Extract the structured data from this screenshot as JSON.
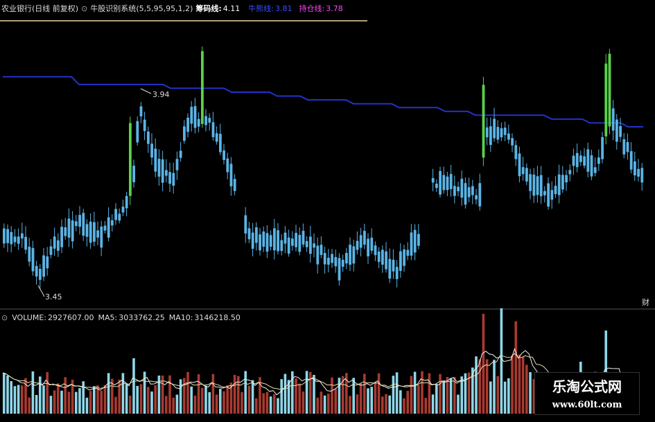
{
  "header": {
    "stock_title": "农业银行(日线 前复权)",
    "indicator_name": "牛股识别系统",
    "indicator_params": "(5,5,95,95,1,2)",
    "chip_line_label": "筹码线:",
    "chip_line_value": "4.11",
    "bull_line_label": "牛熊线:",
    "bull_line_value": "3.81",
    "hold_line_label": "持仓线:",
    "hold_line_value": "3.78",
    "colors": {
      "chip": "#ffffff",
      "bull": "#3b4cff",
      "hold": "#ff44ff"
    }
  },
  "volume_header": {
    "volume_label": "VOLUME:",
    "volume_value": "2927607.00",
    "ma5_label": "MA5:",
    "ma5_value": "3033762.25",
    "ma10_label": "MA10:",
    "ma10_value": "3146218.50"
  },
  "side_marker": "财",
  "watermark": {
    "name": "乐淘公式网",
    "url": "www.60lt.com"
  },
  "chart_data": [
    {
      "type": "candlestick",
      "price_high_label": "3.94",
      "price_low_label": "3.45",
      "colors": {
        "up": "#5ab4e6",
        "breakout": "#5bd24a",
        "line": "#2233cc"
      },
      "bull_bear_line": [
        3.98,
        3.98,
        3.98,
        3.98,
        3.98,
        3.98,
        3.98,
        3.98,
        3.98,
        3.98,
        3.96,
        3.96,
        3.96,
        3.96,
        3.96,
        3.96,
        3.96,
        3.96,
        3.96,
        3.96,
        3.96,
        3.96,
        3.95,
        3.95,
        3.95,
        3.95,
        3.95,
        3.95,
        3.95,
        3.95,
        3.94,
        3.94,
        3.94,
        3.94,
        3.94,
        3.94,
        3.93,
        3.93,
        3.93,
        3.93,
        3.92,
        3.92,
        3.92,
        3.92,
        3.92,
        3.92,
        3.91,
        3.91,
        3.91,
        3.91,
        3.91,
        3.91,
        3.9,
        3.9,
        3.9,
        3.9,
        3.9,
        3.9,
        3.89,
        3.89,
        3.89,
        3.89,
        3.88,
        3.88,
        3.88,
        3.88,
        3.88,
        3.88,
        3.88,
        3.88,
        3.88,
        3.88,
        3.87,
        3.87,
        3.87,
        3.87,
        3.87,
        3.86,
        3.86,
        3.86,
        3.86,
        3.86,
        3.85,
        3.85,
        3.85
      ]
    },
    {
      "type": "bar",
      "series": "volume",
      "colors": {
        "up": "#a83a30",
        "down": "#8ed6e8",
        "ma": "#f0f0f0"
      }
    }
  ]
}
